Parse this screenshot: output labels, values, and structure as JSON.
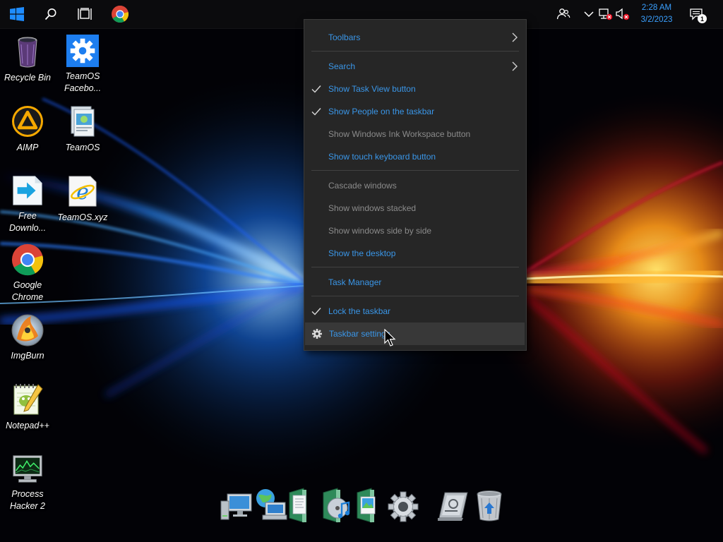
{
  "taskbar": {
    "start": {
      "icon": "windows-logo-icon"
    },
    "search": {
      "icon": "search-icon"
    },
    "task_view": {
      "icon": "task-view-icon"
    },
    "pinned": [
      {
        "name": "Google Chrome",
        "icon": "chrome-icon"
      }
    ],
    "tray": {
      "people_icon": "people-icon",
      "overflow_icon": "chevron-up-icon",
      "network_icon": "network-disconnected-icon",
      "volume_icon": "volume-muted-icon",
      "notifications_icon": "notification-icon",
      "notifications_count": "1"
    },
    "clock": {
      "time": "2:28 AM",
      "date": "3/2/2023"
    }
  },
  "desktop_icons": [
    {
      "label": "Recycle Bin",
      "icon": "recycle-bin-icon"
    },
    {
      "label": "TeamOS Facebo...",
      "icon": "gear-settings-icon"
    },
    {
      "label": "AIMP",
      "icon": "aimp-icon"
    },
    {
      "label": "TeamOS",
      "icon": "folder-documents-icon"
    },
    {
      "label": "Free Downlo...",
      "icon": "free-download-manager-icon"
    },
    {
      "label": "TeamOS.xyz",
      "icon": "internet-explorer-icon"
    },
    {
      "label": "Google Chrome",
      "icon": "chrome-icon"
    },
    {
      "label": "ImgBurn",
      "icon": "imgburn-disc-icon"
    },
    {
      "label": "Notepad++",
      "icon": "notepad-plus-plus-icon"
    },
    {
      "label": "Process Hacker 2",
      "icon": "process-hacker-icon"
    }
  ],
  "context_menu": {
    "items": [
      {
        "label": "Toolbars",
        "enabled": true,
        "submenu": true,
        "checked": false
      },
      {
        "label": "Search",
        "enabled": true,
        "submenu": true,
        "checked": false
      },
      {
        "label": "Show Task View button",
        "enabled": true,
        "checked": true
      },
      {
        "label": "Show People on the taskbar",
        "enabled": true,
        "checked": true
      },
      {
        "label": "Show Windows Ink Workspace button",
        "enabled": false,
        "checked": false
      },
      {
        "label": "Show touch keyboard button",
        "enabled": true,
        "checked": false
      },
      {
        "label": "Cascade windows",
        "enabled": false,
        "checked": false
      },
      {
        "label": "Show windows stacked",
        "enabled": false,
        "checked": false
      },
      {
        "label": "Show windows side by side",
        "enabled": false,
        "checked": false
      },
      {
        "label": "Show the desktop",
        "enabled": true,
        "checked": false
      },
      {
        "label": "Task Manager",
        "enabled": true,
        "checked": false
      },
      {
        "label": "Lock the taskbar",
        "enabled": true,
        "checked": true
      },
      {
        "label": "Taskbar settings",
        "enabled": true,
        "checked": false,
        "icon": "gear-icon",
        "hovered": true
      }
    ]
  },
  "dock": {
    "items": [
      {
        "icon": "computer-icon"
      },
      {
        "icon": "network-globe-icon"
      },
      {
        "icon": "documents-folder-icon"
      },
      {
        "icon": "music-folder-icon"
      },
      {
        "icon": "pictures-folder-icon"
      },
      {
        "icon": "settings-gear-icon"
      },
      {
        "icon": "control-panel-icon"
      },
      {
        "icon": "trash-icon"
      }
    ]
  },
  "colors": {
    "menu_enabled_text": "#3a96e8",
    "menu_disabled_text": "#8b8b8b",
    "clock_text": "#3aa0ff",
    "menu_background": "#262626"
  }
}
